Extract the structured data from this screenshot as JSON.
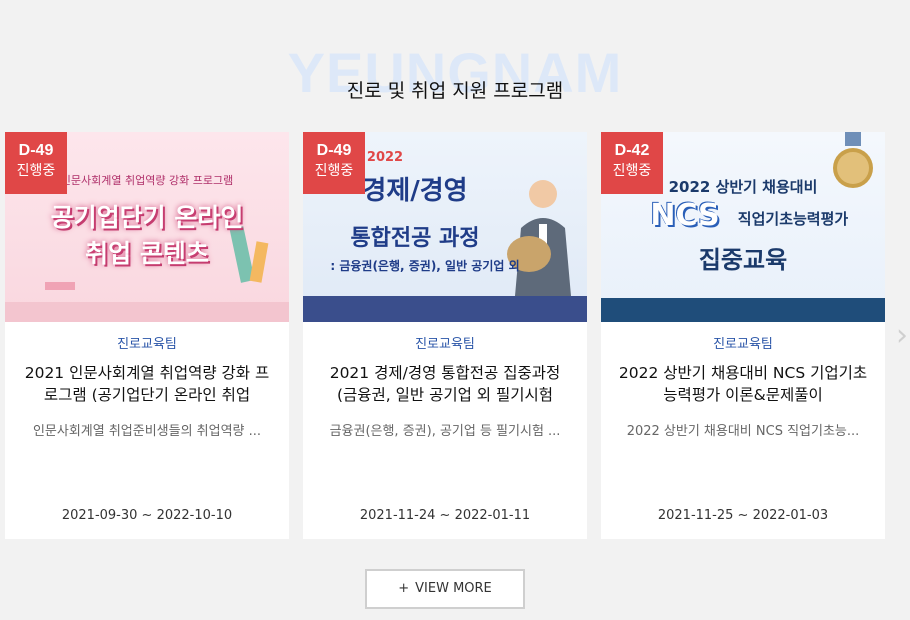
{
  "section": {
    "bg_text": "YEUNGNAM",
    "title": "진로 및 취업 지원 프로그램"
  },
  "cards": [
    {
      "badge_dday": "D-49",
      "badge_state": "진행중",
      "thumb_small": "인문사회계열 취업역량 강화 프로그램",
      "thumb_line1": "공기업단기 온라인",
      "thumb_line2": "취업 콘텐츠",
      "category": "진로교육팀",
      "title": "2021 인문사회계열 취업역량 강화 프로그램 (공기업단기 온라인 취업",
      "desc": "인문사회계열 취업준비생들의 취업역량 ...",
      "period": "2021-09-30 ~ 2022-10-10"
    },
    {
      "badge_dday": "D-49",
      "badge_state": "진행중",
      "thumb_year": "2022",
      "thumb_line1": "경제/경영",
      "thumb_line2": "통합전공 과정",
      "thumb_line3": ": 금융권(은행, 증권), 일반 공기업 외",
      "category": "진로교육팀",
      "title": "2021 경제/경영 통합전공 집중과정 (금융권, 일반 공기업 외 필기시험",
      "desc": "금융권(은행, 증권), 공기업 등 필기시험 ...",
      "period": "2021-11-24 ~ 2022-01-11"
    },
    {
      "badge_dday": "D-42",
      "badge_state": "진행중",
      "thumb_line1": "2022 상반기 채용대비",
      "thumb_ncs": "NCS",
      "thumb_line2": "직업기초능력평가",
      "thumb_line3": "집중교육",
      "thumb_medal": "1위",
      "category": "진로교육팀",
      "title": "2022 상반기 채용대비 NCS 기업기초능력평가 이론&문제풀이",
      "desc": "2022 상반기 채용대비 NCS 직업기초능...",
      "period": "2021-11-25 ~ 2022-01-03"
    }
  ],
  "more_button": {
    "plus": "+",
    "label": "VIEW MORE"
  },
  "icons": {
    "prev": "chevron-left-icon",
    "next": "chevron-right-icon"
  },
  "colors": {
    "badge": "#e04747",
    "category": "#2a55a8",
    "background": "#f2f2f2"
  }
}
